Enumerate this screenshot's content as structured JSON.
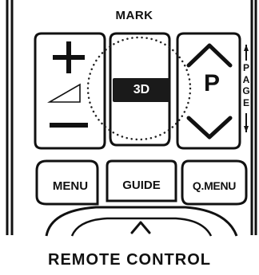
{
  "remote": {
    "mark_label": "MARK",
    "three_d_label": "3D",
    "page_button_label": "P",
    "page_side_label": [
      "P",
      "A",
      "G",
      "E"
    ],
    "menu_label": "MENU",
    "guide_label": "GUIDE",
    "qmenu_label": "Q.MENU",
    "volume_up_icon": "plus-icon",
    "volume_down_icon": "minus-icon",
    "volume_ramp_icon": "volume-ramp-icon",
    "page_up_icon": "chevron-up-icon",
    "page_down_icon": "chevron-down-icon",
    "nav_up_icon": "chevron-up-icon"
  },
  "caption": "REMOTE CONTROL",
  "colors": {
    "ink": "#111111",
    "three_d_button_bg": "#1a1a1a",
    "background": "#ffffff"
  }
}
